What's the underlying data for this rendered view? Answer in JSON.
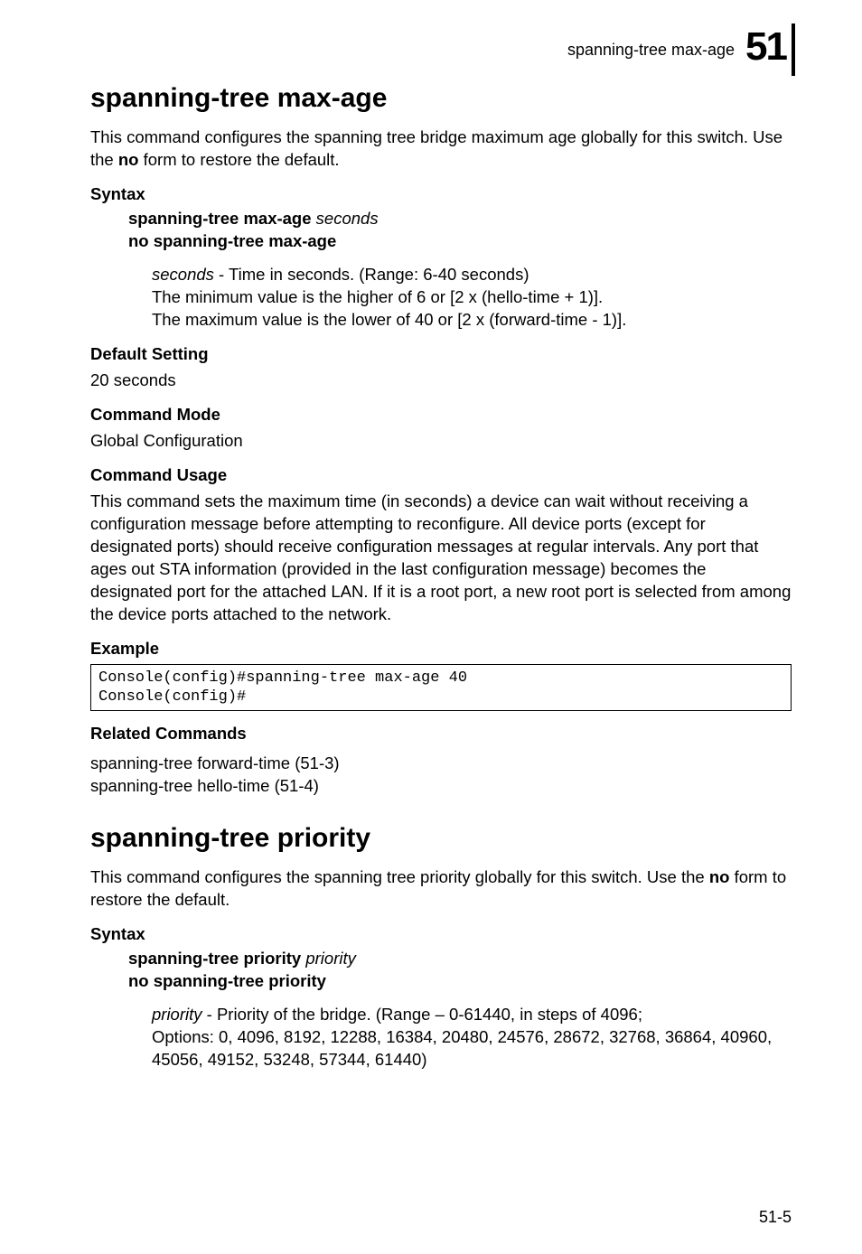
{
  "header": {
    "running_title": "spanning-tree max-age",
    "chapter_number": "51"
  },
  "section1": {
    "title": "spanning-tree max-age",
    "lead_a": "This command configures the spanning tree bridge maximum age globally for this switch. Use the ",
    "lead_bold": "no",
    "lead_b": " form to restore the default.",
    "syntax_label": "Syntax",
    "syntax_cmd_bold": "spanning-tree max-age",
    "syntax_cmd_ital": "seconds",
    "syntax_no": "no spanning-tree max-age",
    "param_ital": "seconds",
    "param_desc": " - Time in seconds. (Range: 6-40 seconds)",
    "param_min": "The minimum value is the higher of 6 or [2 x (hello-time + 1)].",
    "param_max": "The maximum value is the lower of 40 or [2 x (forward-time - 1)].",
    "default_label": "Default Setting",
    "default_value": "20 seconds",
    "mode_label": "Command Mode",
    "mode_value": "Global Configuration",
    "usage_label": "Command Usage",
    "usage_text": "This command sets the maximum time (in seconds) a device can wait without receiving a configuration message before attempting to reconfigure. All device ports (except for designated ports) should receive configuration messages at regular intervals. Any port that ages out STA information (provided in the last configuration message) becomes the designated port for the attached LAN. If it is a root port, a new root port is selected from among the device ports attached to the network.",
    "example_label": "Example",
    "example_code": "Console(config)#spanning-tree max-age 40\nConsole(config)#",
    "related_label": "Related Commands",
    "related_1": "spanning-tree forward-time (51-3)",
    "related_2": "spanning-tree hello-time (51-4)"
  },
  "section2": {
    "title": "spanning-tree priority",
    "lead_a": "This command configures the spanning tree priority globally for this switch. Use the ",
    "lead_bold": "no",
    "lead_b": " form to restore the default.",
    "syntax_label": "Syntax",
    "syntax_cmd_bold": "spanning-tree priority",
    "syntax_cmd_ital": "priority",
    "syntax_no": "no spanning-tree priority",
    "param_ital": "priority",
    "param_desc": " - Priority of the bridge. (Range – 0-61440, in steps of 4096;",
    "param_line2": "Options: 0, 4096, 8192, 12288, 16384, 20480, 24576, 28672, 32768, 36864, 40960, 45056, 49152, 53248, 57344, 61440)"
  },
  "footer": {
    "page_number": "51-5"
  }
}
